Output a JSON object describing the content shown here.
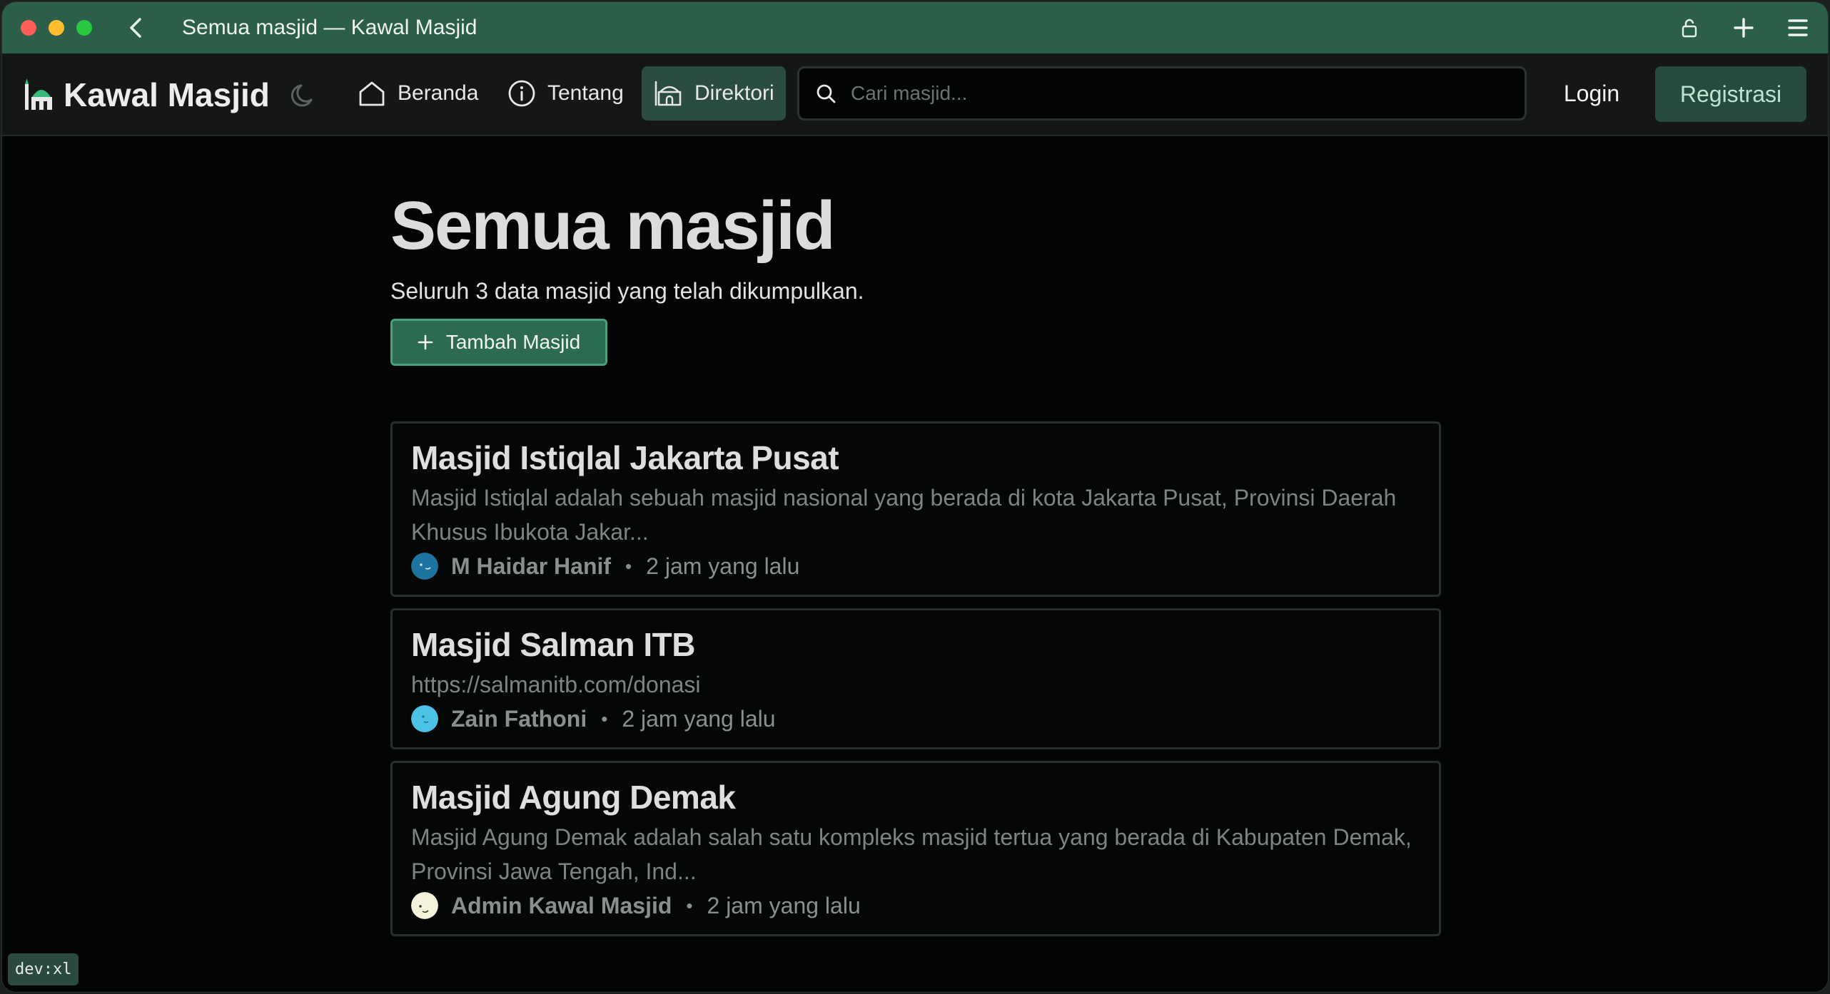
{
  "window": {
    "title": "Semua masjid — Kawal Masjid"
  },
  "navbar": {
    "brand": "Kawal Masjid",
    "links": [
      {
        "label": "Beranda",
        "icon": "home-icon"
      },
      {
        "label": "Tentang",
        "icon": "info-icon"
      },
      {
        "label": "Direktori",
        "icon": "mosque-icon",
        "active": true
      }
    ],
    "search_placeholder": "Cari masjid...",
    "login_label": "Login",
    "register_label": "Registrasi"
  },
  "main": {
    "title": "Semua masjid",
    "subtitle": "Seluruh 3 data masjid yang telah dikumpulkan.",
    "add_button_label": "Tambah Masjid",
    "mosques": [
      {
        "name": "Masjid Istiqlal Jakarta Pusat",
        "description": "Masjid Istiqlal adalah sebuah masjid nasional yang berada di kota Jakarta Pusat, Provinsi Daerah Khusus Ibukota Jakar...",
        "author": "M Haidar Hanif",
        "time": "2 jam yang lalu",
        "avatar_color": "#1d74a0"
      },
      {
        "name": "Masjid Salman ITB",
        "description": "https://salmanitb.com/donasi",
        "author": "Zain Fathoni",
        "time": "2 jam yang lalu",
        "avatar_color": "#4cc3e6"
      },
      {
        "name": "Masjid Agung Demak",
        "description": "Masjid Agung Demak adalah salah satu kompleks masjid tertua yang berada di Kabupaten Demak, Provinsi Jawa Tengah, Ind...",
        "author": "Admin Kawal Masjid",
        "time": "2 jam yang lalu",
        "avatar_color": "#f4f1dc"
      }
    ]
  },
  "dev_badge": "dev:xl",
  "colors": {
    "titlebar": "#2c5f4a",
    "accent": "#2c6b52",
    "background": "#030505"
  }
}
